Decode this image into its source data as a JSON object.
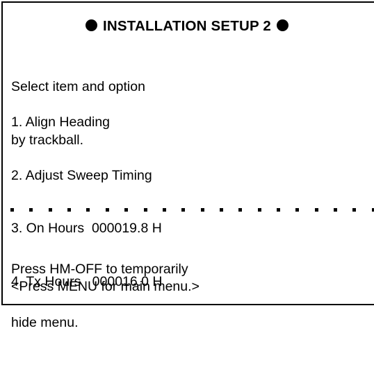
{
  "menu": {
    "title": "INSTALLATION SETUP 2",
    "title_left_icon": "filled-circle-icon",
    "title_right_icon": "filled-circle-icon",
    "instruction_line1": "Select item and option",
    "instruction_line2": "by trackball.",
    "items": [
      {
        "label": "1. Align Heading"
      },
      {
        "label": "2. Adjust Sweep Timing"
      },
      {
        "label": "3. On Hours  000019.8 H"
      },
      {
        "label": "4. Tx Hours   000016.0 H"
      }
    ],
    "hide_hint_line1": "Press HM-OFF to temporarily",
    "hide_hint_line2": "hide menu.",
    "main_menu_hint": "<Press MENU for main menu.>"
  }
}
